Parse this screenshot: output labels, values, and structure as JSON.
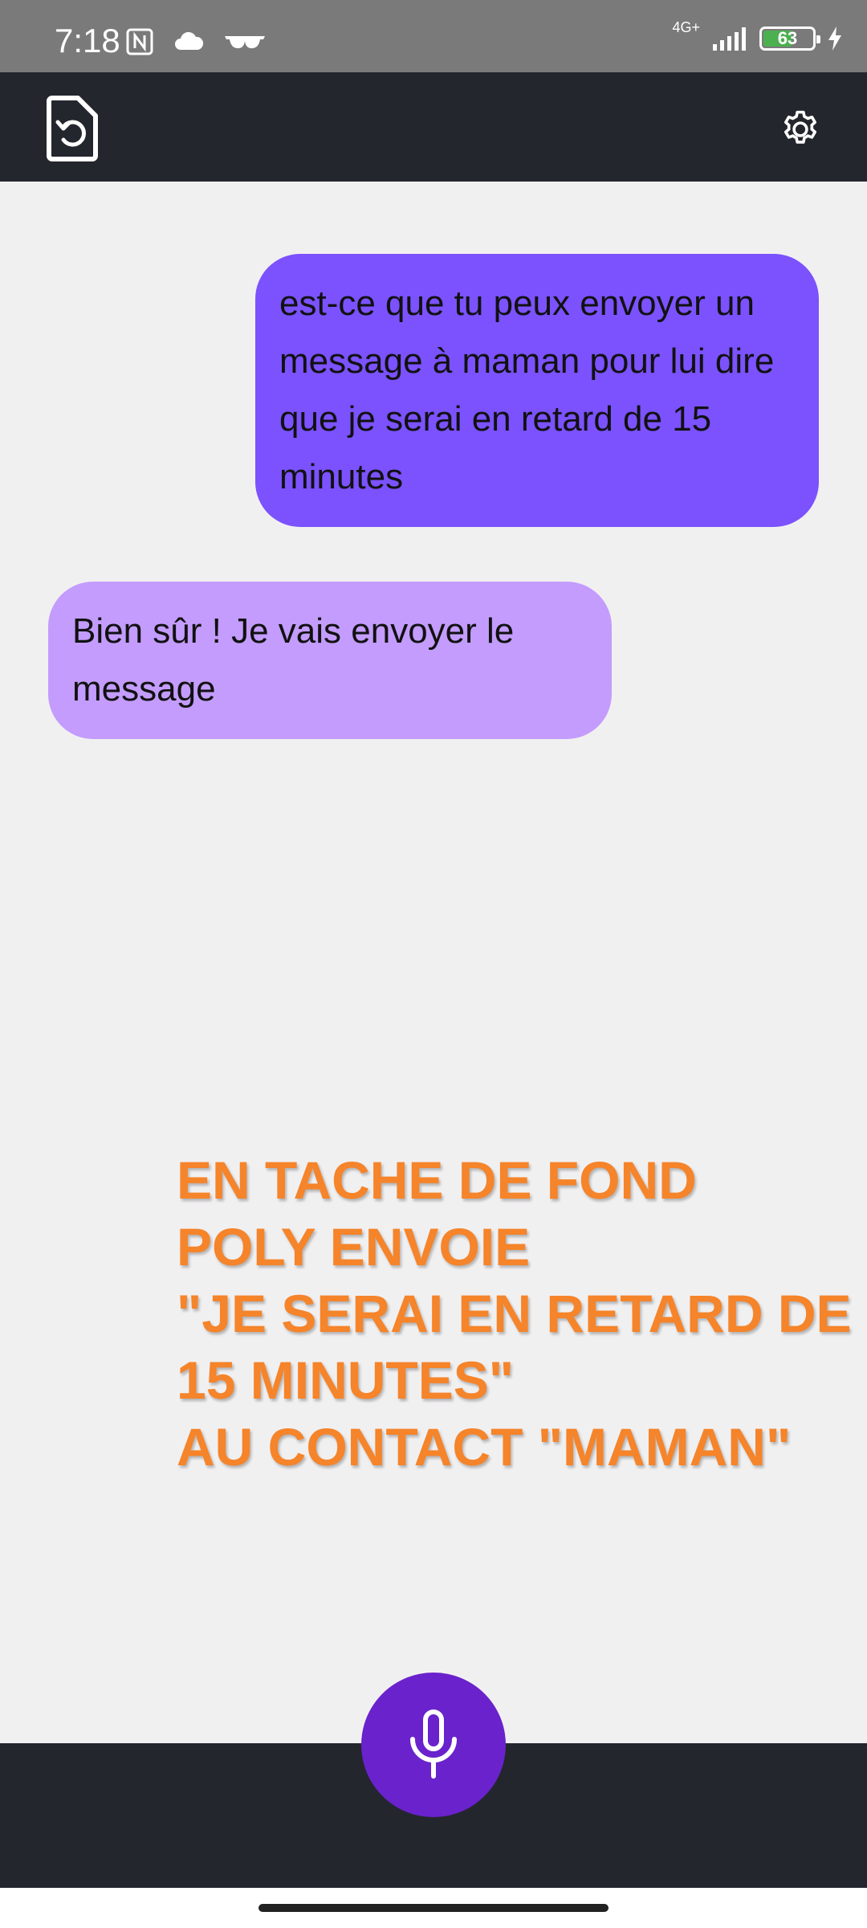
{
  "status_bar": {
    "time": "7:18",
    "network": "4G+",
    "battery_level": "63",
    "battery_fraction": 0.63,
    "icons": [
      "nfc-icon",
      "cloud-icon",
      "glasses-icon",
      "signal-icon",
      "battery-icon",
      "charging-icon"
    ]
  },
  "header": {
    "history_icon": "history-document-icon",
    "settings_icon": "gear-icon"
  },
  "messages": [
    {
      "role": "user",
      "text": "est-ce que tu peux envoyer un message à maman pour lui dire que je serai en retard de 15 minutes"
    },
    {
      "role": "assistant",
      "text": "Bien sûr ! Je vais envoyer le message"
    }
  ],
  "overlay_note": {
    "lines": [
      "EN TACHE DE FOND",
      "POLY ENVOIE",
      "\"JE SERAI EN RETARD DE",
      "15 MINUTES\"",
      "AU CONTACT \"MAMAN\""
    ]
  },
  "colors": {
    "user_bubble": "#7b52fd",
    "assistant_bubble": "#c39cfd",
    "header_bg": "#24262e",
    "mic_button": "#6a22cc",
    "overlay_text": "#f5842a"
  },
  "bottom": {
    "mic_icon": "microphone-icon"
  }
}
